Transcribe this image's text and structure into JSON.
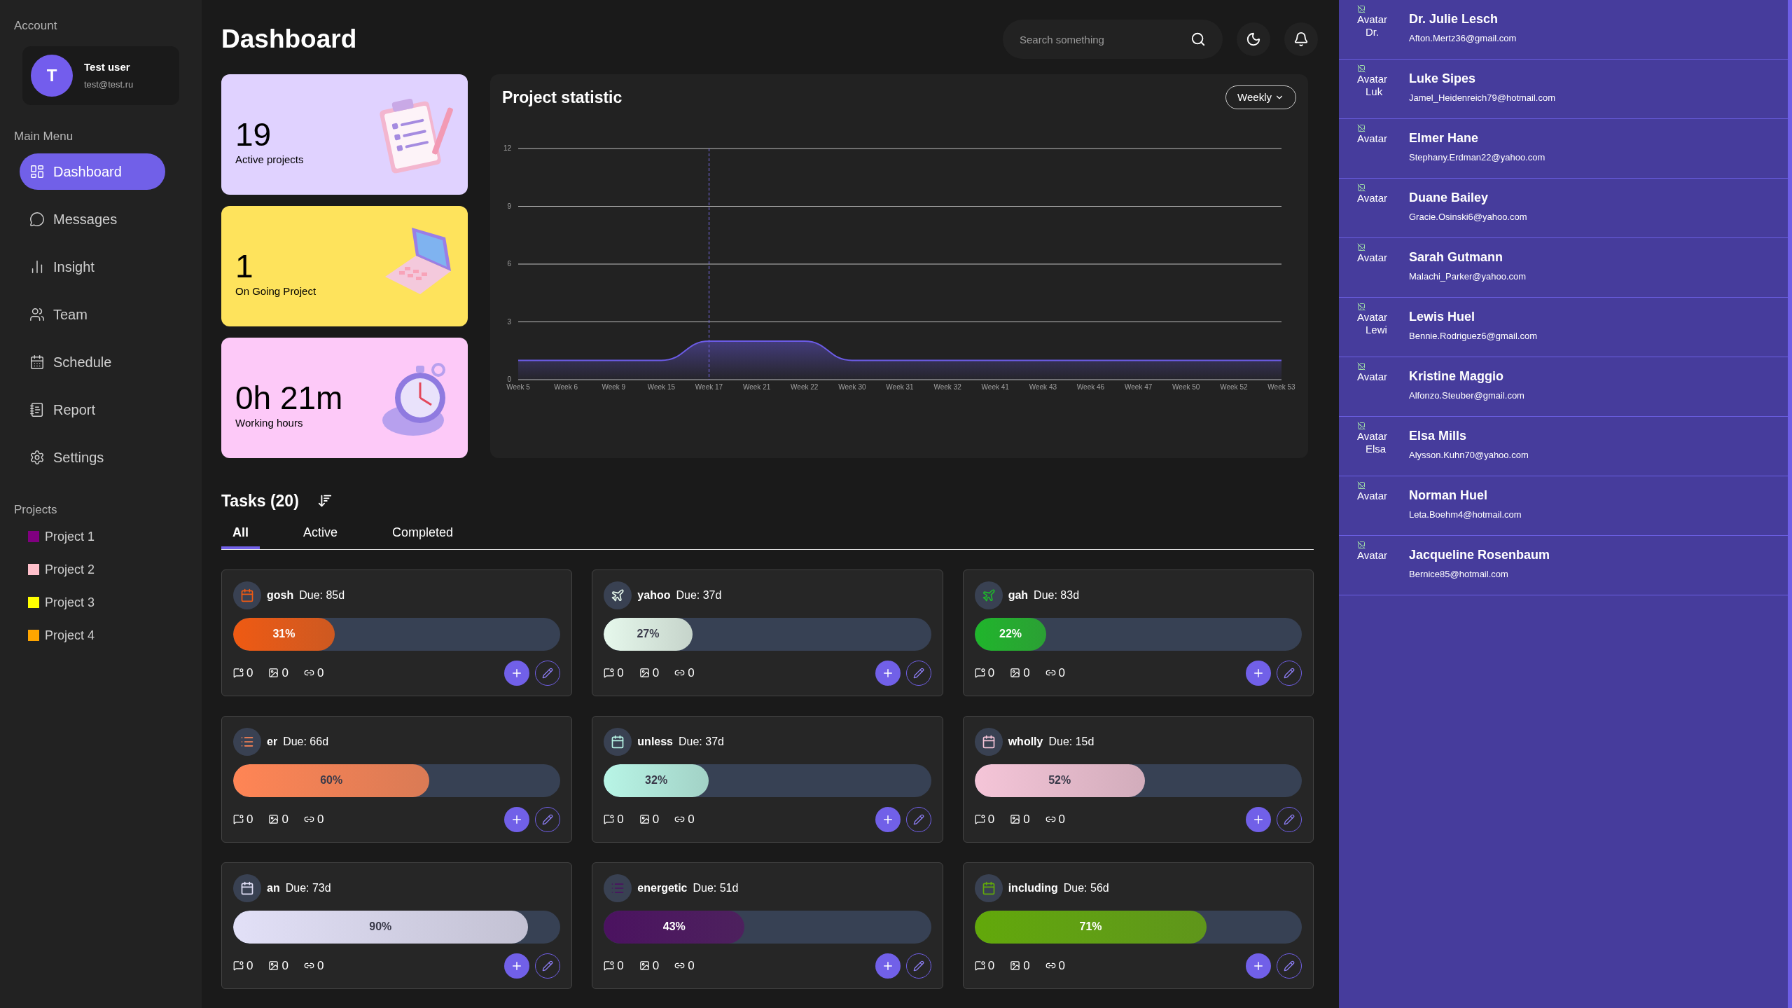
{
  "sidebar": {
    "account_label": "Account",
    "user": {
      "initial": "T",
      "name": "Test user",
      "email": "test@test.ru"
    },
    "menu_label": "Main Menu",
    "menu": [
      {
        "kind": "dashboard",
        "label": "Dashboard",
        "selected": true
      },
      {
        "kind": "messages",
        "label": "Messages",
        "selected": false
      },
      {
        "kind": "insight",
        "label": "Insight",
        "selected": false
      },
      {
        "kind": "team",
        "label": "Team",
        "selected": false
      },
      {
        "kind": "schedule",
        "label": "Schedule",
        "selected": false
      },
      {
        "kind": "report",
        "label": "Report",
        "selected": false
      },
      {
        "kind": "settings",
        "label": "Settings",
        "selected": false
      }
    ],
    "projects_label": "Projects",
    "projects": [
      {
        "label": "Project 1",
        "color": "#800080"
      },
      {
        "label": "Project 2",
        "color": "#ffc0cb"
      },
      {
        "label": "Project 3",
        "color": "#ffff00"
      },
      {
        "label": "Project 4",
        "color": "#ffa500"
      }
    ]
  },
  "header": {
    "title": "Dashboard",
    "search": {
      "placeholder": "Search something"
    }
  },
  "stats": [
    {
      "kind": "clipboard",
      "value": "19",
      "label": "Active projects",
      "color": "#e0d2ff"
    },
    {
      "kind": "laptop",
      "value": "1",
      "label": "On Going Project",
      "color": "#fee35c"
    },
    {
      "kind": "stopwatch",
      "value": "0h 21m",
      "label": "Working hours",
      "color": "#fdc9f8"
    }
  ],
  "project_statistic": {
    "title": "Project statistic",
    "period": "Weekly",
    "chart_data": {
      "type": "area",
      "categories": [
        "Week 5",
        "Week 6",
        "Week 9",
        "Week 15",
        "Week 17",
        "Week 21",
        "Week 22",
        "Week 30",
        "Week 31",
        "Week 32",
        "Week 41",
        "Week 43",
        "Week 46",
        "Week 47",
        "Week 50",
        "Week 52",
        "Week 53"
      ],
      "series": [
        {
          "color": "#6c5ce7",
          "values": [
            1,
            1,
            1,
            1,
            2,
            2,
            2,
            1,
            1,
            1,
            1,
            1,
            1,
            1,
            1,
            1,
            1
          ]
        }
      ],
      "grid": true,
      "ref_lines": [
        {
          "axis": "x",
          "value": "Week 17",
          "color": "#7b6df0"
        }
      ],
      "ylim": [
        0,
        12
      ],
      "yticks": [
        0,
        3,
        6,
        9,
        12
      ]
    }
  },
  "tasks": {
    "title": "Tasks (20)",
    "tabs": [
      {
        "label": "All",
        "selected": true
      },
      {
        "label": "Active",
        "selected": false
      },
      {
        "label": "Completed",
        "selected": false
      }
    ],
    "items": [
      {
        "kind": "calendar",
        "name": "gosh",
        "due": "Due: 85d",
        "level": 0.31,
        "percent": "31%",
        "color": "#ef5a12",
        "comments": "0",
        "images": "0",
        "links": "0"
      },
      {
        "kind": "plane",
        "name": "yahoo",
        "due": "Due: 37d",
        "level": 0.27,
        "percent": "27%",
        "color": "#e6f8ec",
        "comments": "0",
        "images": "0",
        "links": "0"
      },
      {
        "kind": "plane",
        "name": "gah",
        "due": "Due: 83d",
        "level": 0.22,
        "percent": "22%",
        "color": "#1fb52b",
        "comments": "0",
        "images": "0",
        "links": "0"
      },
      {
        "kind": "list",
        "name": "er",
        "due": "Due: 66d",
        "level": 0.6,
        "percent": "60%",
        "color": "#ff8555",
        "comments": "0",
        "images": "0",
        "links": "0"
      },
      {
        "kind": "calendar",
        "name": "unless",
        "due": "Due: 37d",
        "level": 0.32,
        "percent": "32%",
        "color": "#b8f5e6",
        "comments": "0",
        "images": "0",
        "links": "0"
      },
      {
        "kind": "calendar",
        "name": "wholly",
        "due": "Due: 15d",
        "level": 0.52,
        "percent": "52%",
        "color": "#f5c5d8",
        "comments": "0",
        "images": "0",
        "links": "0"
      },
      {
        "kind": "calendar",
        "name": "an",
        "due": "Due: 73d",
        "level": 0.9,
        "percent": "90%",
        "color": "#e2e0f7",
        "comments": "0",
        "images": "0",
        "links": "0"
      },
      {
        "kind": "list",
        "name": "energetic",
        "due": "Due: 51d",
        "level": 0.43,
        "percent": "43%",
        "color": "#4b1260",
        "comments": "0",
        "images": "0",
        "links": "0"
      },
      {
        "kind": "calendar",
        "name": "including",
        "due": "Due: 56d",
        "level": 0.71,
        "percent": "71%",
        "color": "#62a80a",
        "comments": "0",
        "images": "0",
        "links": "0"
      }
    ]
  },
  "people": [
    {
      "avatar_alt": "Avatar",
      "avatar_caption": "Dr.",
      "name": "Dr. Julie Lesch",
      "email": "Afton.Mertz36@gmail.com"
    },
    {
      "avatar_alt": "Avatar",
      "avatar_caption": "Luk",
      "name": "Luke Sipes",
      "email": "Jamel_Heidenreich79@hotmail.com"
    },
    {
      "avatar_alt": "Avatar",
      "name": "Elmer Hane",
      "email": "Stephany.Erdman22@yahoo.com"
    },
    {
      "avatar_alt": "Avatar",
      "name": "Duane Bailey",
      "email": "Gracie.Osinski6@yahoo.com"
    },
    {
      "avatar_alt": "Avatar",
      "name": "Sarah Gutmann",
      "email": "Malachi_Parker@yahoo.com"
    },
    {
      "avatar_alt": "Avatar",
      "avatar_caption": "Lewi",
      "name": "Lewis Huel",
      "email": "Bennie.Rodriguez6@gmail.com"
    },
    {
      "avatar_alt": "Avatar",
      "name": "Kristine Maggio",
      "email": "Alfonzo.Steuber@gmail.com"
    },
    {
      "avatar_alt": "Avatar",
      "avatar_caption": "Elsa",
      "name": "Elsa Mills",
      "email": "Alysson.Kuhn70@yahoo.com"
    },
    {
      "avatar_alt": "Avatar",
      "name": "Norman Huel",
      "email": "Leta.Boehm4@hotmail.com"
    },
    {
      "avatar_alt": "Avatar",
      "name": "Jacqueline Rosenbaum",
      "email": "Bernice85@hotmail.com"
    }
  ]
}
